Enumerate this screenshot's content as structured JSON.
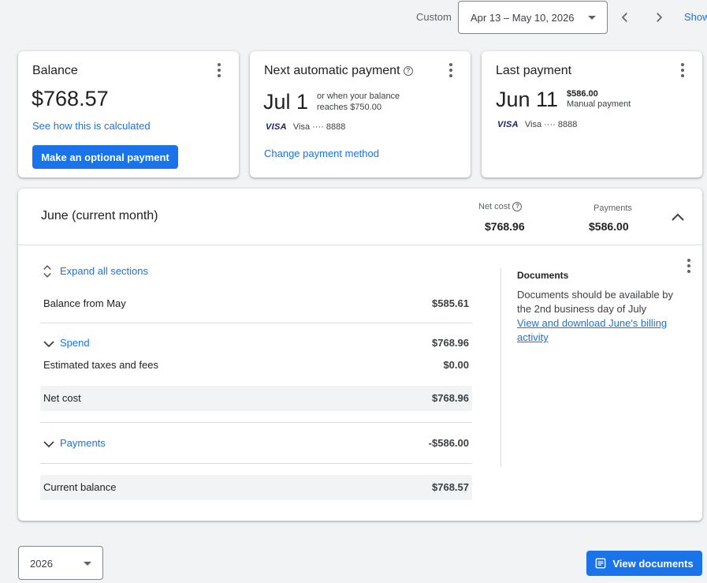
{
  "toolbar": {
    "range_label": "Custom",
    "date_range": "Apr 13 – May 10, 2026",
    "show_link": "Show"
  },
  "balance_card": {
    "title": "Balance",
    "amount": "$768.57",
    "calc_link": "See how this is calculated",
    "pay_button": "Make an optional payment"
  },
  "next_payment_card": {
    "title": "Next automatic payment",
    "date": "Jul 1",
    "note_line1": "or when your balance",
    "note_line2": "reaches $750.00",
    "card_brand": "VISA",
    "card_info": "Visa ···· 8888",
    "change_link": "Change payment method"
  },
  "last_payment_card": {
    "title": "Last payment",
    "date": "Jun 11",
    "amount": "$586.00",
    "method": "Manual payment",
    "card_brand": "VISA",
    "card_info": "Visa ···· 8888"
  },
  "summary": {
    "title": "June (current month)",
    "net_cost_label": "Net cost",
    "net_cost_value": "$768.96",
    "payments_label": "Payments",
    "payments_value": "$586.00",
    "expand_all": "Expand all sections",
    "rows": [
      {
        "label": "Balance from May",
        "amount": "$585.61"
      },
      {
        "label": "Spend",
        "amount": "$768.96"
      },
      {
        "label": "Estimated taxes and fees",
        "amount": "$0.00"
      },
      {
        "label": "Net cost",
        "amount": "$768.96"
      },
      {
        "label": "Payments",
        "amount": "-$586.00"
      },
      {
        "label": "Current balance",
        "amount": "$768.57"
      }
    ],
    "documents": {
      "title": "Documents",
      "text": "Documents should be available by the 2nd business day of July",
      "link": "View and download June's billing activity"
    }
  },
  "footer": {
    "year": "2026",
    "view_documents": "View documents"
  },
  "colors": {
    "accent": "#1a73e8",
    "background": "#f1f3f4",
    "visa": "#1a1f71"
  }
}
